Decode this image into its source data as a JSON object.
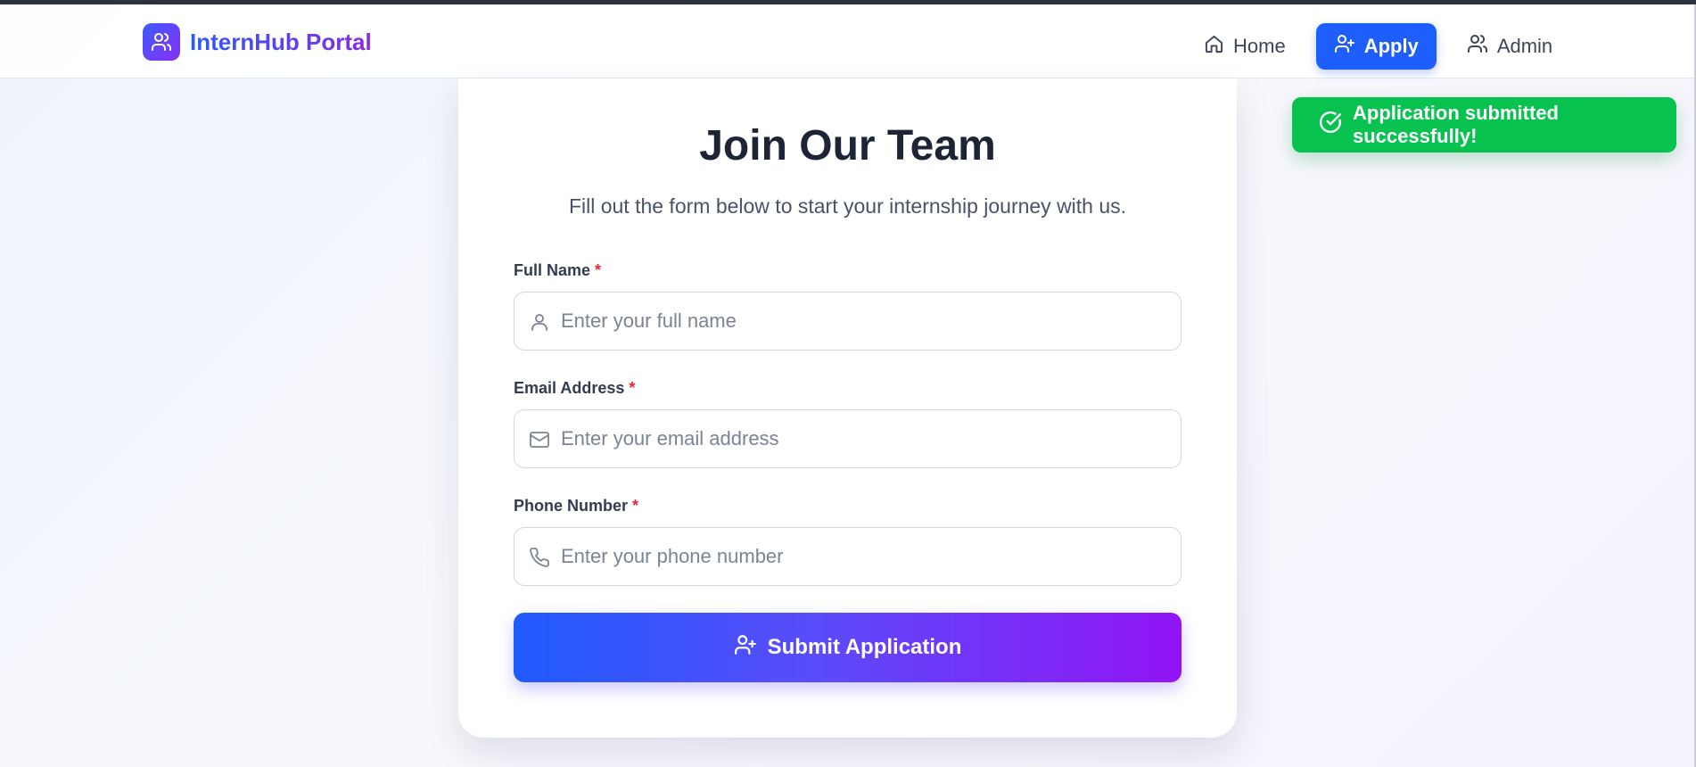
{
  "brand": {
    "name": "InternHub Portal",
    "logo_icon": "users-icon"
  },
  "nav": {
    "items": [
      {
        "label": "Home",
        "icon": "home-icon",
        "active": false
      },
      {
        "label": "Apply",
        "icon": "user-plus-icon",
        "active": true
      },
      {
        "label": "Admin",
        "icon": "users-icon",
        "active": false
      }
    ]
  },
  "form": {
    "title": "Join Our Team",
    "subtitle": "Fill out the form below to start your internship journey with us.",
    "required_marker": "*",
    "fields": [
      {
        "label": "Full Name",
        "placeholder": "Enter your full name",
        "value": "",
        "icon": "user-icon"
      },
      {
        "label": "Email Address",
        "placeholder": "Enter your email address",
        "value": "",
        "icon": "mail-icon"
      },
      {
        "label": "Phone Number",
        "placeholder": "Enter your phone number",
        "value": "",
        "icon": "phone-icon"
      }
    ],
    "submit_label": "Submit Application",
    "submit_icon": "user-plus-icon"
  },
  "toast": {
    "message": "Application submitted successfully!",
    "icon": "check-circle-icon"
  },
  "colors": {
    "accent": "#1e5efc",
    "brand_gradient_start": "#3b5bff",
    "brand_gradient_end": "#8b2ff5",
    "success": "#08c250",
    "required": "#e5283b"
  }
}
